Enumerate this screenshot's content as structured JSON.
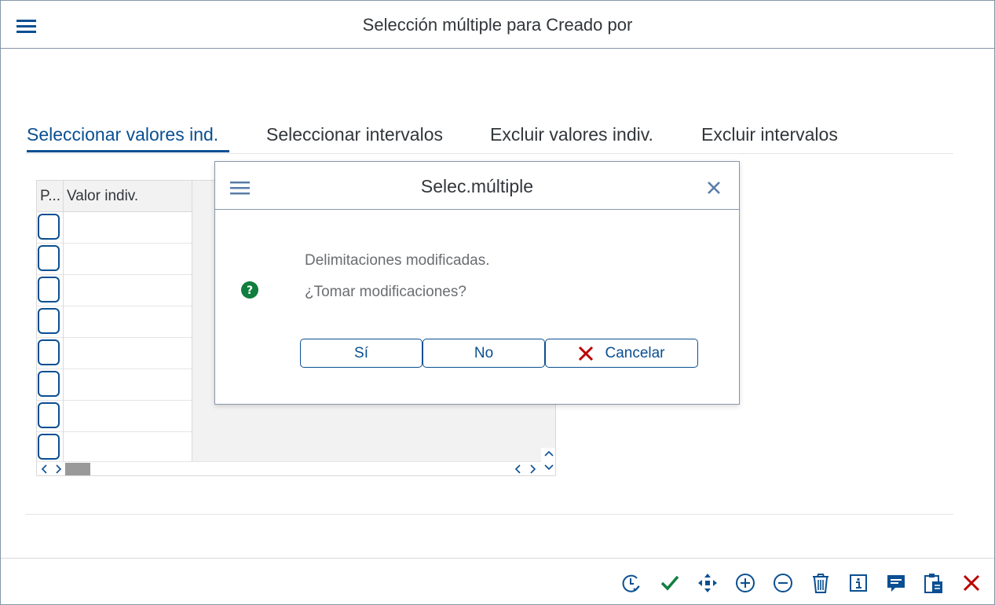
{
  "window": {
    "title": "Selección múltiple para Creado por"
  },
  "tabs": [
    {
      "label": "Seleccionar valores ind."
    },
    {
      "label": "Seleccionar intervalos"
    },
    {
      "label": "Excluir valores indiv."
    },
    {
      "label": "Excluir intervalos"
    }
  ],
  "table": {
    "columns": [
      {
        "label": "P..."
      },
      {
        "label": "Valor indiv."
      }
    ],
    "row_count": 8
  },
  "dialog": {
    "title": "Selec.múltiple",
    "message_line1": "Delimitaciones modificadas.",
    "message_line2": "¿Tomar modificaciones?",
    "buttons": {
      "yes": "Sí",
      "no": "No",
      "cancel": "Cancelar"
    }
  },
  "toolbar": {
    "icons": [
      "history-icon",
      "check-icon",
      "move-icon",
      "add-circle-icon",
      "remove-circle-icon",
      "trash-icon",
      "info-icon",
      "comment-icon",
      "paste-icon",
      "close-icon"
    ]
  },
  "colors": {
    "brand_blue": "#0a4f91",
    "accept_green": "#107e3e",
    "reject_red": "#bb0000",
    "border": "#8696a9"
  }
}
